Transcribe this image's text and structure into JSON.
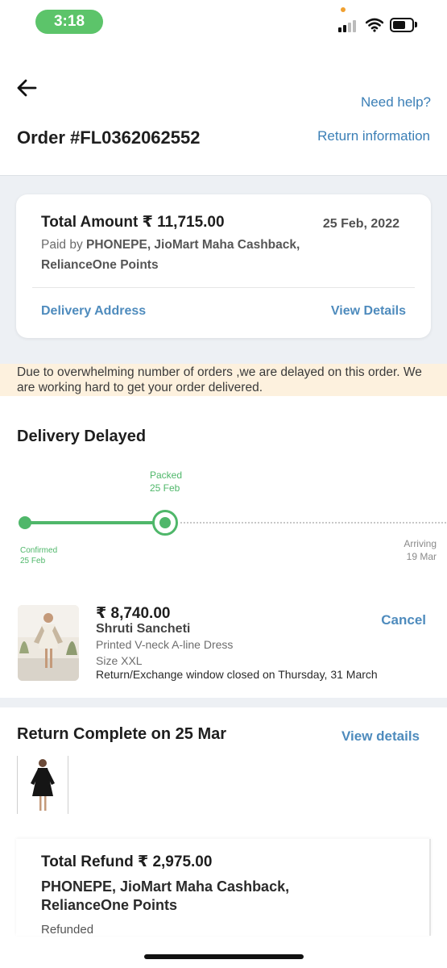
{
  "status_bar": {
    "time": "3:18"
  },
  "header": {
    "need_help": "Need help?",
    "order_id": "Order #FL0362062552",
    "return_information": "Return information"
  },
  "summary_card": {
    "total_amount": "Total Amount ₹ 11,715.00",
    "date": "25 Feb, 2022",
    "paid_by_prefix": "Paid by ",
    "paid_by_methods": "PHONEPE, JioMart Maha Cashback, RelianceOne Points",
    "delivery_address": "Delivery Address",
    "view_details": "View Details"
  },
  "notice": "Due to overwhelming number of orders ,we are delayed on this order. We are working hard to get your order delivered.",
  "tracker": {
    "title": "Delivery Delayed",
    "packed": {
      "label": "Packed",
      "date": "25 Feb"
    },
    "confirmed": {
      "label": "Confirmed",
      "date": "25 Feb"
    },
    "arriving": {
      "label": "Arriving",
      "date": "19 Mar"
    }
  },
  "product": {
    "price": "₹ 8,740.00",
    "brand": "Shruti Sancheti",
    "name": "Printed V-neck A-line Dress",
    "size": "Size XXL",
    "return_window": "Return/Exchange window closed on Thursday, 31 March",
    "cancel": "Cancel"
  },
  "return_section": {
    "title": "Return Complete on 25 Mar",
    "view_details": "View details",
    "total_refund": "Total Refund ₹ 2,975.00",
    "methods": "PHONEPE, JioMart Maha Cashback, RelianceOne Points",
    "status": "Refunded"
  },
  "colors": {
    "link": "#3b7fb6",
    "success": "#4fb76a",
    "notice_bg": "#fdf1de",
    "band_bg": "#edf0f4"
  }
}
